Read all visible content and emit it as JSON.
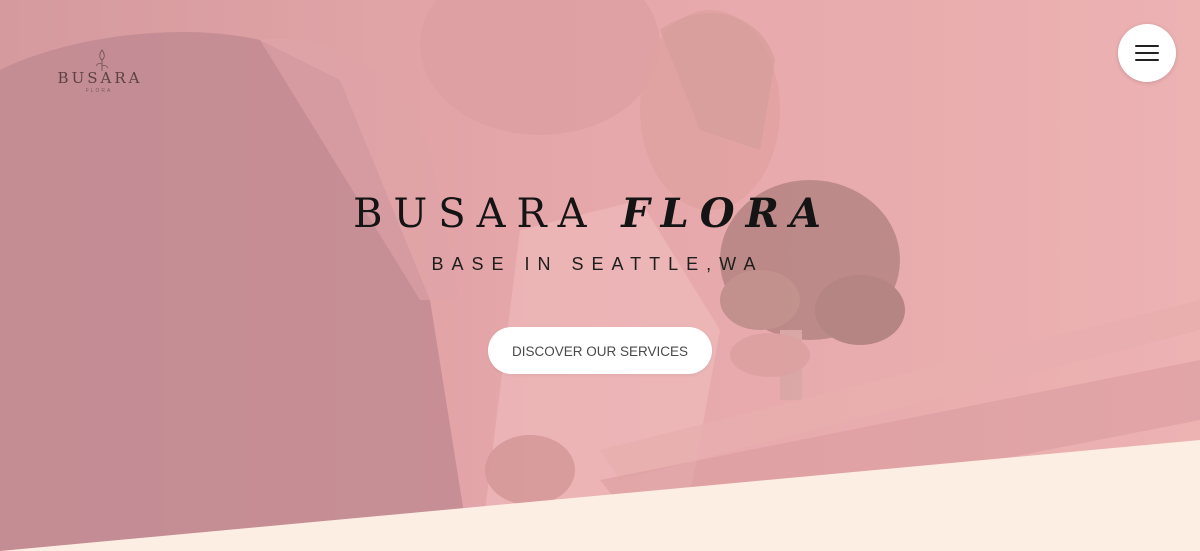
{
  "header": {
    "logo": {
      "wordmark": "BUSARA",
      "subtext": "FLORA"
    },
    "menu_icon": "hamburger-menu-icon"
  },
  "hero": {
    "title_main": "BUSARA",
    "title_italic": "FLORA",
    "subtitle": "BASE IN SEATTLE,WA",
    "cta_label": "DISCOVER OUR SERVICES",
    "background_image": "wedding couple walking down stairs, bride holding bouquet"
  },
  "colors": {
    "overlay_pink": "#e2a9aa",
    "bottom_cream": "#fdeee3",
    "title_text": "#141414",
    "button_bg": "#ffffff",
    "button_text": "#4a4a4a"
  }
}
